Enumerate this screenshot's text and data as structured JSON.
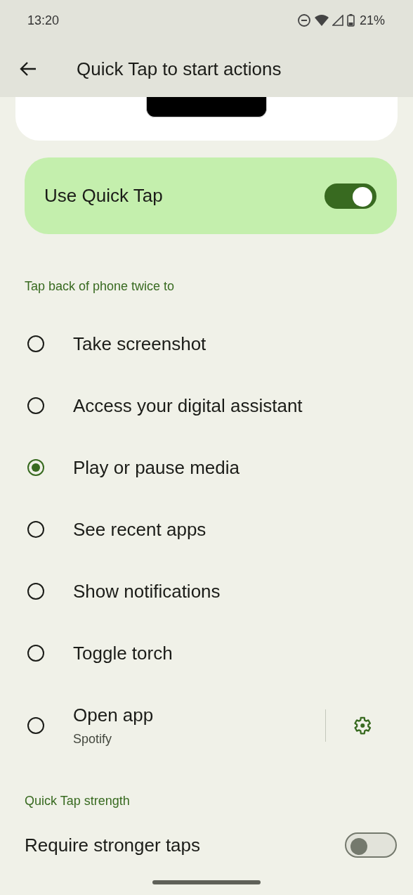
{
  "status_bar": {
    "time": "13:20",
    "battery": "21%"
  },
  "app_bar": {
    "title": "Quick Tap to start actions"
  },
  "main_switch": {
    "label": "Use Quick Tap",
    "on": true
  },
  "sections": [
    {
      "header": "Tap back of phone twice to",
      "options": [
        {
          "kind": "radio",
          "label": "Take screenshot",
          "selected": false
        },
        {
          "kind": "radio",
          "label": "Access your digital assistant",
          "selected": false
        },
        {
          "kind": "radio",
          "label": "Play or pause media",
          "selected": true
        },
        {
          "kind": "radio",
          "label": "See recent apps",
          "selected": false
        },
        {
          "kind": "radio",
          "label": "Show notifications",
          "selected": false
        },
        {
          "kind": "radio",
          "label": "Toggle torch",
          "selected": false
        },
        {
          "kind": "radio_settings",
          "label": "Open app",
          "summary": "Spotify",
          "selected": false
        }
      ]
    },
    {
      "header": "Quick Tap strength",
      "options": [
        {
          "kind": "switch",
          "label": "Require stronger taps",
          "on": false
        }
      ]
    }
  ]
}
